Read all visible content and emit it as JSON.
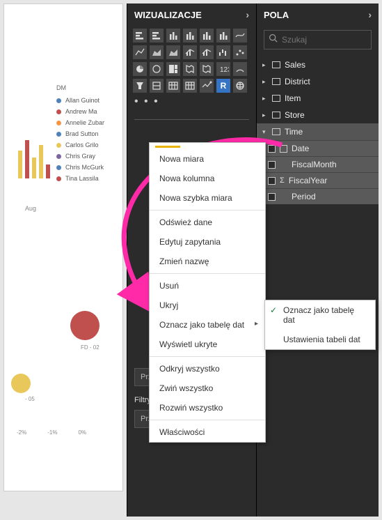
{
  "legend": {
    "title": "DM",
    "items": [
      {
        "label": "Allan Guinot",
        "color": "#4f81bd"
      },
      {
        "label": "Andrew Ma",
        "color": "#c0504d"
      },
      {
        "label": "Annelie Zubar",
        "color": "#f79646"
      },
      {
        "label": "Brad Sutton",
        "color": "#4f81bd"
      },
      {
        "label": "Carlos Grilo",
        "color": "#e8c85a"
      },
      {
        "label": "Chris Gray",
        "color": "#8064a2"
      },
      {
        "label": "Chris McGurk",
        "color": "#4f81bd"
      },
      {
        "label": "Tina Lassila",
        "color": "#c0504d"
      }
    ]
  },
  "axis": {
    "month": "Aug"
  },
  "bubbles": {
    "fd": "FD - 02",
    "p": "- 05"
  },
  "ticks": [
    "-2%",
    "-1%",
    "0%"
  ],
  "viz": {
    "header": "WIZUALIZACJE",
    "drag1": "Przeciągnij tutaj pola przegl…",
    "filterReport": "Filtry na poziomie raportu",
    "drag2": "Przeciągnij pola danych tutaj"
  },
  "fields": {
    "header": "POLA",
    "search_ph": "Szukaj",
    "tables": [
      "Sales",
      "District",
      "Item",
      "Store",
      "Time"
    ],
    "time_fields": [
      {
        "label": "Date",
        "kind": "date"
      },
      {
        "label": "FiscalMonth",
        "kind": "text"
      },
      {
        "label": "FiscalYear",
        "kind": "sigma"
      },
      {
        "label": "Period",
        "kind": "text"
      }
    ]
  },
  "ctx": {
    "items": [
      "Nowa miara",
      "Nowa kolumna",
      "Nowa szybka miara",
      "-",
      "Odśwież dane",
      "Edytuj zapytania",
      "Zmień nazwę",
      "-",
      "Usuń",
      "Ukryj",
      "Oznacz jako tabelę dat>",
      "Wyświetl ukryte",
      "-",
      "Odkryj wszystko",
      "Zwiń wszystko",
      "Rozwiń wszystko",
      "-",
      "Właściwości"
    ]
  },
  "submenu": {
    "mark": "Oznacz jako tabelę dat",
    "settings": "Ustawienia tabeli dat"
  },
  "viz_icons": [
    "bar-stacked",
    "bar-clustered",
    "column-stacked",
    "column-clustered",
    "column-100",
    "column-line",
    "ribbon",
    "line",
    "area",
    "area-stacked",
    "combo",
    "combo2",
    "waterfall",
    "scatter",
    "pie",
    "donut",
    "treemap",
    "map",
    "filled-map",
    "card",
    "gauge",
    "funnel",
    "slicer",
    "table",
    "matrix",
    "kpi",
    "r-visual",
    "globe"
  ]
}
